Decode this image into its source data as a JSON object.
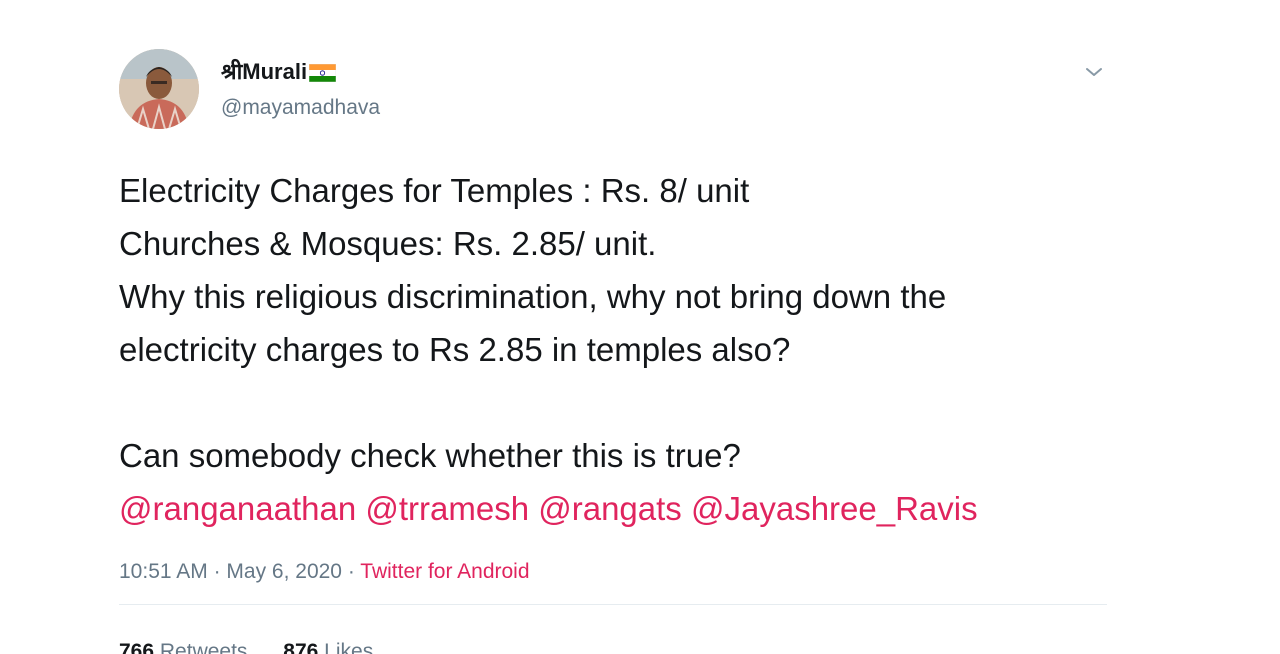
{
  "author": {
    "display_name": "श्रीMurali",
    "flag_icon": "india-flag-icon",
    "handle": "@mayamadhava"
  },
  "menu_icon": "chevron-down-icon",
  "tweet": {
    "lines": [
      "Electricity Charges for Temples : Rs. 8/ unit",
      "Churches & Mosques: Rs. 2.85/ unit.",
      "Why this religious discrimination, why not bring down the",
      "electricity charges to Rs 2.85 in temples also?"
    ],
    "question": "Can somebody check whether this is true?",
    "mentions": [
      "@ranganaathan",
      "@trramesh",
      "@rangats",
      "@Jayashree_Ravis"
    ]
  },
  "meta": {
    "time": "10:51 AM",
    "separator": " · ",
    "date": "May 6, 2020",
    "source": "Twitter for Android"
  },
  "stats": {
    "retweets_count": "766",
    "retweets_label": "Retweets",
    "likes_count": "876",
    "likes_label": "Likes"
  },
  "colors": {
    "accent": "#e0245e",
    "secondary_text": "#657786",
    "primary_text": "#14171a"
  }
}
